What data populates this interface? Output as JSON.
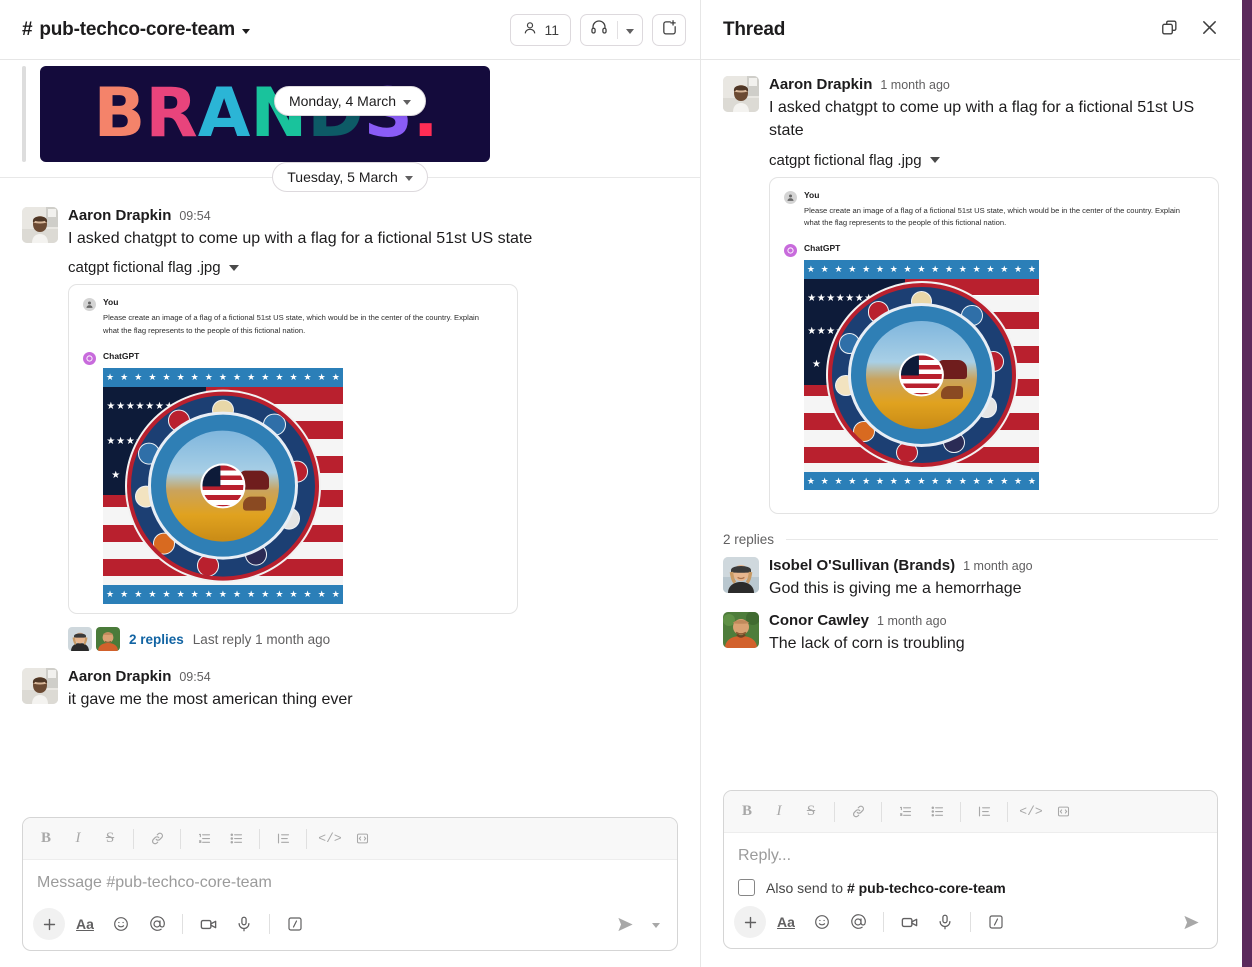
{
  "channel": {
    "name": "pub-techco-core-team",
    "hash": "#",
    "member_count": "11",
    "icons": {
      "members": "person-icon",
      "huddle": "headphones-icon",
      "huddle_caret": "chevron-down-icon",
      "new_canvas": "add-canvas-icon",
      "title_caret": "chevron-down-icon"
    }
  },
  "date_dividers": {
    "monday": "Monday, 4 March",
    "tuesday": "Tuesday, 5 March"
  },
  "banner": {
    "alt": "BRANDS.",
    "letters": [
      "B",
      "R",
      "A",
      "N",
      "D",
      "S",
      "."
    ]
  },
  "messages": [
    {
      "author": "Aaron Drapkin",
      "time": "09:54",
      "text": "I asked chatgpt to come up with a flag for a fictional 51st US state",
      "file_name": "catgpt fictional flag .jpg",
      "replies_link": "2 replies",
      "last_reply": "Last reply 1 month ago"
    },
    {
      "author": "Aaron Drapkin",
      "time": "09:54",
      "text": "it gave me the most american thing ever"
    }
  ],
  "attachment": {
    "user_label": "You",
    "user_prompt": "Please create an image of a flag of a fictional 51st US state, which would be in the center of the country. Explain what the flag represents to the people of this fictional nation.",
    "bot_label": "ChatGPT",
    "image_alt": "American flag with large circular medallion of prairie, bison, wheat and eagle imagery"
  },
  "composer": {
    "placeholder": "Message #pub-techco-core-team",
    "format_buttons": [
      {
        "name": "bold",
        "glyph": "B"
      },
      {
        "name": "italic",
        "glyph": "I"
      },
      {
        "name": "strikethrough",
        "glyph": "S"
      },
      {
        "name": "link",
        "glyph": "link"
      },
      {
        "name": "ordered-list",
        "glyph": "ol"
      },
      {
        "name": "bulleted-list",
        "glyph": "ul"
      },
      {
        "name": "blockquote",
        "glyph": "quote"
      },
      {
        "name": "code",
        "glyph": "code"
      },
      {
        "name": "code-block",
        "glyph": "code-block"
      }
    ],
    "action_buttons": [
      {
        "name": "attach",
        "glyph": "+"
      },
      {
        "name": "formatting",
        "glyph": "Aa"
      },
      {
        "name": "emoji",
        "glyph": "emoji"
      },
      {
        "name": "mention",
        "glyph": "@"
      },
      {
        "name": "video",
        "glyph": "video"
      },
      {
        "name": "audio",
        "glyph": "mic"
      },
      {
        "name": "slash-command",
        "glyph": "slash"
      }
    ],
    "send_label": "send-icon",
    "send_caret": "chevron-down-icon"
  },
  "thread": {
    "title": "Thread",
    "open_window_icon": "open-in-new-window-icon",
    "close_icon": "close-icon",
    "root": {
      "author": "Aaron Drapkin",
      "time": "1 month ago",
      "text": "I asked chatgpt to come up with a flag for a fictional 51st US state",
      "file_name": "catgpt fictional flag .jpg"
    },
    "replies_count": "2 replies",
    "replies": [
      {
        "author": "Isobel O'Sullivan (Brands)",
        "time": "1 month ago",
        "text": "God this is giving me a hemorrhage"
      },
      {
        "author": "Conor Cawley",
        "time": "1 month ago",
        "text": "The lack of corn is troubling"
      }
    ],
    "composer": {
      "placeholder": "Reply...",
      "also_send_prefix": "Also send to",
      "also_send_channel": "# pub-techco-core-team"
    }
  },
  "colors": {
    "link": "#1264a3",
    "sidebar_purple": "#5c2a5c",
    "banner_bg": "#140b3c",
    "text": "#1d1c1d",
    "muted": "#616061"
  }
}
